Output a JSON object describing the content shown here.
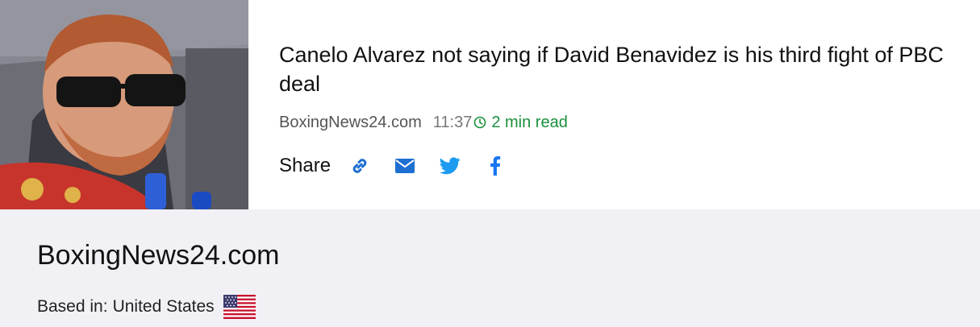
{
  "article": {
    "thumbnail": {
      "description_icon": "article-photo",
      "alt": ""
    },
    "headline": "Canelo Alvarez not saying if David Benavidez is his third fight of PBC deal",
    "source": "BoxingNews24.com",
    "time": "11:37",
    "read_time_icon": "clock-icon",
    "read_time": "2 min read",
    "share": {
      "label": "Share",
      "buttons": [
        {
          "icon": "link-icon",
          "color": "#1d6fd1"
        },
        {
          "icon": "mail-icon",
          "color": "#1d6fd1"
        },
        {
          "icon": "twitter-icon",
          "color": "#1d9bf0"
        },
        {
          "icon": "facebook-icon",
          "color": "#1877f2"
        }
      ]
    }
  },
  "source_panel": {
    "name": "BoxingNews24.com",
    "based_in_label": "Based in:",
    "country": "United States",
    "flag_icon": "us-flag-icon"
  },
  "colors": {
    "read_time": "#1a8f3c",
    "panel_background": "#f1f0f5"
  }
}
